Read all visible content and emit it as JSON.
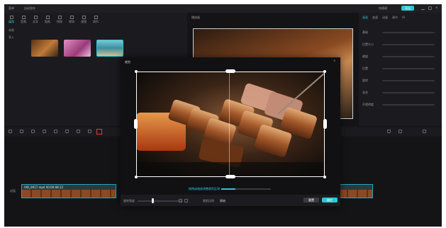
{
  "window": {
    "menu_labels": [
      "菜单",
      "自动保存"
    ],
    "titlebar_right": "快捷键",
    "export_label": "导出"
  },
  "media_panel": {
    "tab_labels": [
      "媒体",
      "音频",
      "文本",
      "贴纸",
      "特效",
      "转场",
      "滤镜",
      "调节"
    ],
    "side_items": [
      "本地",
      "导入"
    ],
    "thumbnails": [
      {
        "name": "food-thumbnail",
        "color": "#7a4a28"
      },
      {
        "name": "flower-thumbnail",
        "color": "#b25a8a"
      },
      {
        "name": "beach-thumbnail",
        "color": "#3c8fa0"
      }
    ]
  },
  "player": {
    "label": "播放器"
  },
  "properties": {
    "tabs": [
      "画面",
      "变速",
      "动画",
      "调节",
      "AI"
    ],
    "rows": [
      "基础",
      "位置大小",
      "缩放",
      "位置",
      "旋转",
      "混合",
      "不透明度"
    ]
  },
  "crop_dialog": {
    "title": "裁剪",
    "info_text": "拖拽或缩放调整裁剪区域",
    "rotate_label": "旋转角度",
    "ratio_label": "裁剪比例",
    "ratio_value": "原始",
    "reset_label": "重置",
    "confirm_label": "确定"
  },
  "timeline": {
    "clip_label": "VID_0917.mp4  00:00:08:12",
    "track_label": "封面"
  },
  "colors": {
    "accent": "#2ec5d3",
    "crop_tool_highlight": "#e0392f"
  }
}
